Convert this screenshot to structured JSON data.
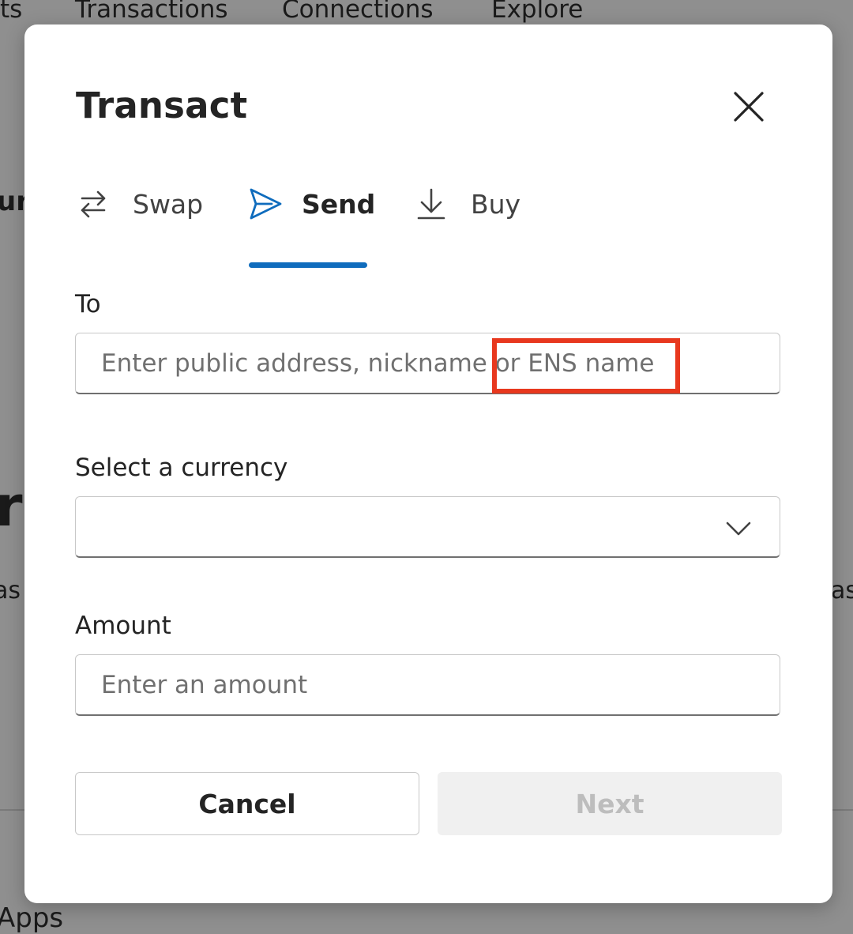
{
  "background": {
    "nav_items": [
      "ts",
      "Transactions",
      "Connections",
      "Explore"
    ],
    "fragments": [
      "ur",
      "r",
      "as",
      "as",
      "Apps"
    ]
  },
  "dialog": {
    "title": "Transact",
    "close_icon": "close-icon",
    "tabs": [
      {
        "label": "Swap",
        "icon": "swap-arrows-icon",
        "active": false
      },
      {
        "label": "Send",
        "icon": "send-icon",
        "active": true
      },
      {
        "label": "Buy",
        "icon": "download-arrow-icon",
        "active": false
      }
    ],
    "to": {
      "label": "To",
      "placeholder": "Enter public address, nickname or ENS name",
      "value": ""
    },
    "currency": {
      "label": "Select a currency",
      "value": "",
      "icon": "chevron-down-icon"
    },
    "amount": {
      "label": "Amount",
      "placeholder": "Enter an amount",
      "value": ""
    },
    "buttons": {
      "cancel": "Cancel",
      "next": "Next",
      "next_enabled": false
    }
  },
  "colors": {
    "accent": "#0f6cbd",
    "highlight": "#e8381e",
    "overlay": "#8f8f8f"
  }
}
